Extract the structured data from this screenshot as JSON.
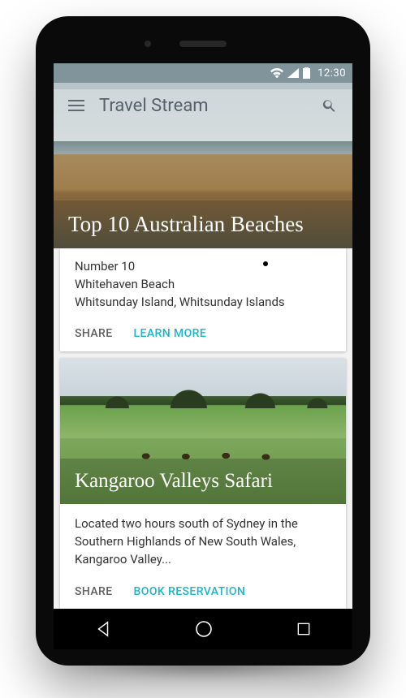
{
  "status": {
    "time": "12:30"
  },
  "appbar": {
    "title": "Travel Stream"
  },
  "cards": [
    {
      "title": "Top 10 Australian Beaches",
      "body_line1": "Number 10",
      "body_line2": "Whitehaven Beach",
      "body_line3": "Whitsunday Island, Whitsunday Islands",
      "action_share": "SHARE",
      "action_primary": "LEARN MORE"
    },
    {
      "title": "Kangaroo Valleys Safari",
      "body": "Located two hours south of Sydney in the Southern Highlands of New South Wales, Kangaroo Valley...",
      "action_share": "SHARE",
      "action_primary": "BOOK RESERVATION"
    }
  ]
}
